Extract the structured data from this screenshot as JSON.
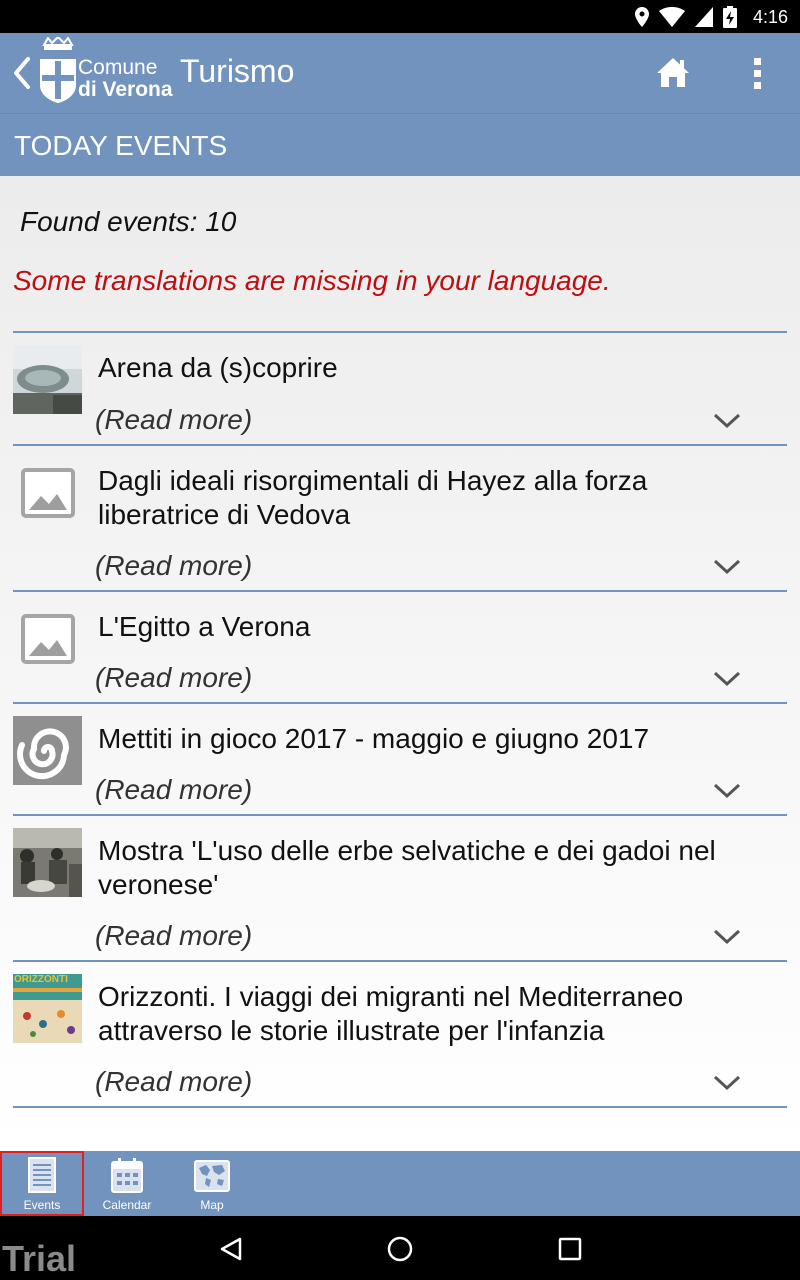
{
  "status_bar": {
    "time": "4:16",
    "icons": [
      "location-icon",
      "wifi-icon",
      "signal-icon",
      "battery-charging-icon"
    ]
  },
  "app_bar": {
    "back_icon": "chevron-left-icon",
    "logo_line1": "Comune",
    "logo_line2": "di Verona",
    "title": "Turismo",
    "home_icon": "home-icon",
    "menu_icon": "more-vert-icon"
  },
  "section": {
    "title": "TODAY EVENTS"
  },
  "summary": {
    "found": "Found events: 10",
    "warning": "Some translations are missing in your language."
  },
  "colors": {
    "accent": "#7193bd",
    "warning": "#bf0e10",
    "active_tab_outline": "#e41f1f"
  },
  "events": [
    {
      "title": "Arena da (s)coprire",
      "read_more": "(Read more)",
      "thumb": "arena-photo"
    },
    {
      "title": "Dagli ideali risorgimentali di Hayez alla forza liberatrice di Vedova",
      "read_more": "(Read more)",
      "thumb": "image-placeholder-icon"
    },
    {
      "title": "L'Egitto a Verona",
      "read_more": "(Read more)",
      "thumb": "image-placeholder-icon"
    },
    {
      "title": "Mettiti in gioco 2017 - maggio e giugno 2017",
      "read_more": "(Read more)",
      "thumb": "spiral-logo"
    },
    {
      "title": "Mostra 'L'uso delle erbe selvatiche e dei gadoi nel veronese'",
      "read_more": "(Read more)",
      "thumb": "vintage-photo"
    },
    {
      "title": "Orizzonti. I viaggi dei migranti nel Mediterraneo attraverso le storie illustrate per l'infanzia",
      "read_more": "(Read more)",
      "thumb": "orizzonti-poster"
    }
  ],
  "orizzonti_thumb": {
    "heading": "ORIZZONTI"
  },
  "bottom_nav": {
    "tabs": [
      {
        "label": "Events",
        "icon": "list-document-icon",
        "active": true
      },
      {
        "label": "Calendar",
        "icon": "calendar-icon",
        "active": false
      },
      {
        "label": "Map",
        "icon": "world-map-icon",
        "active": false
      }
    ]
  },
  "system_nav": {
    "watermark": "Trial"
  }
}
